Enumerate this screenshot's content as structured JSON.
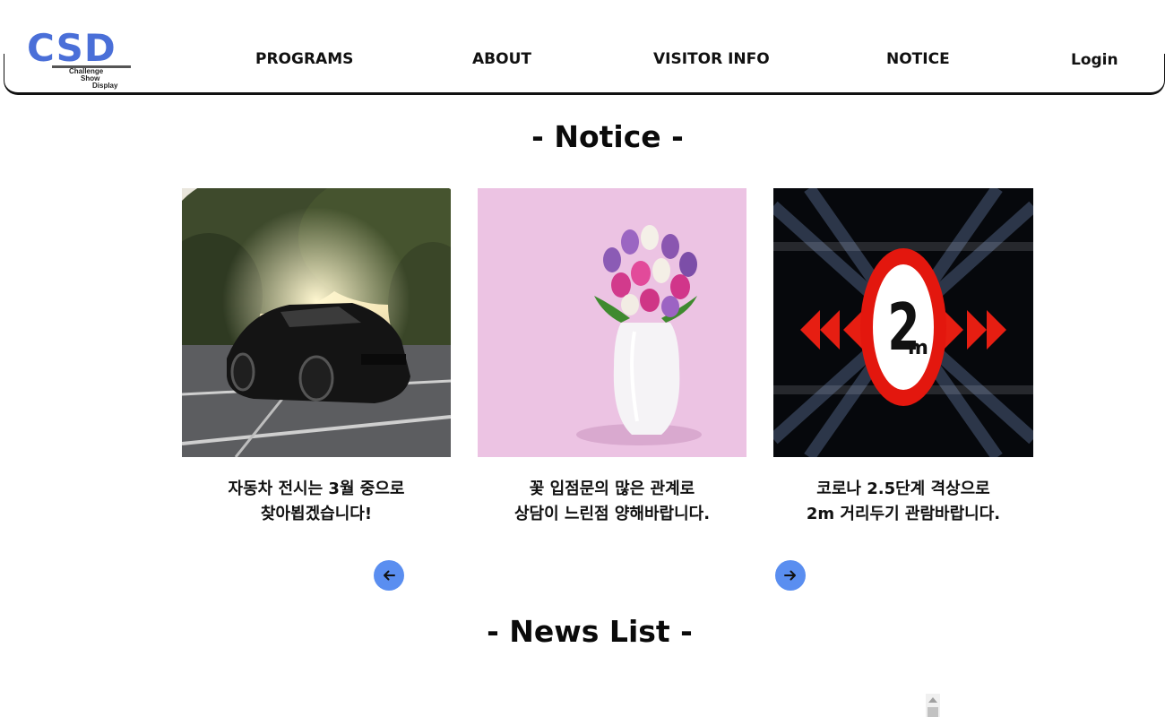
{
  "header": {
    "logo": {
      "main": "CSD",
      "line1": "Challenge",
      "line2": "Show",
      "line3": "Display"
    },
    "nav": [
      {
        "label": "PROGRAMS"
      },
      {
        "label": "ABOUT"
      },
      {
        "label": "VISITOR INFO"
      },
      {
        "label": "NOTICE"
      }
    ],
    "login_label": "Login"
  },
  "notice": {
    "title": "- Notice -",
    "cards": [
      {
        "image": "car-photo",
        "line1": "자동차 전시는 3월 중으로",
        "line2": "찾아뵙겠습니다!"
      },
      {
        "image": "tulip-vase-photo",
        "line1": "꽃 입점문의 많은 관계로",
        "line2": "상담이 느린점 양해바랍니다."
      },
      {
        "image": "2m-distance-sign",
        "line1": "코로나 2.5단계 격상으로",
        "line2": "2m 거리두기 관람바랍니다."
      }
    ],
    "prev_icon": "arrow-left-icon",
    "next_icon": "arrow-right-icon"
  },
  "news": {
    "title": "- News List -"
  },
  "colors": {
    "brand_blue": "#4a6fd8",
    "arrow_button": "#5a8ef0",
    "text": "#111111"
  }
}
